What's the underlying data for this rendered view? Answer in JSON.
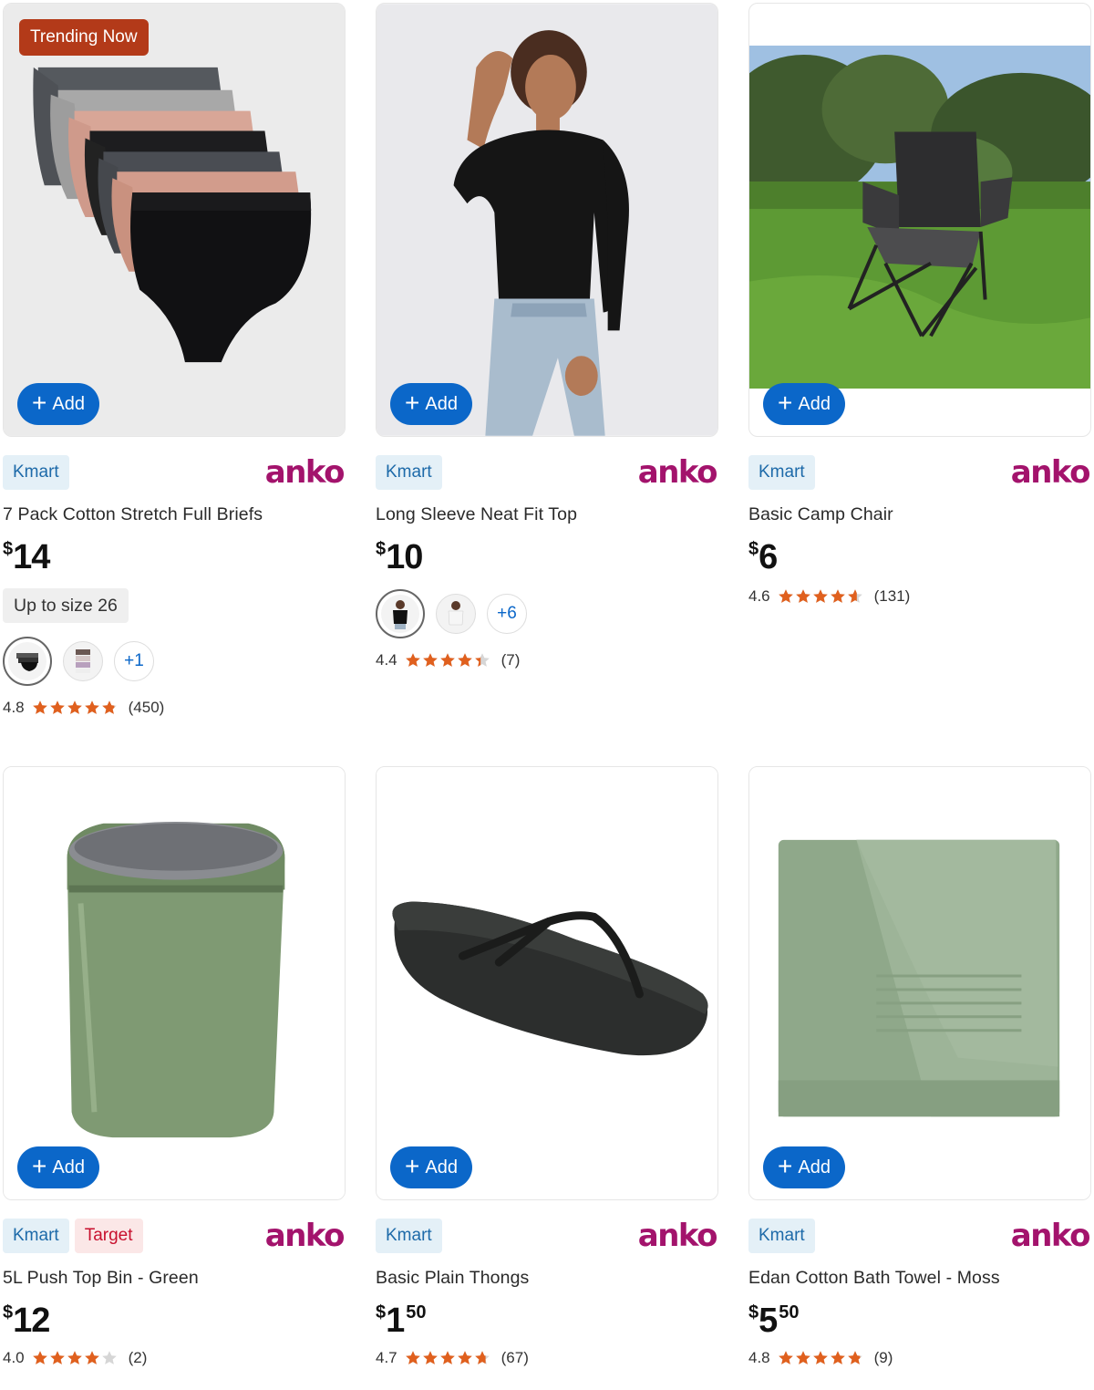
{
  "accent_color": "#0b67c9",
  "star_color": "#e0601e",
  "products": [
    {
      "trending": "Trending Now",
      "add_label": "Add",
      "stores": [
        "Kmart"
      ],
      "brand": "anko",
      "title": "7 Pack Cotton Stretch Full Briefs",
      "price": {
        "currency": "$",
        "whole": "14",
        "cents": ""
      },
      "size_note": "Up to size 26",
      "swatch_more": "+1",
      "rating": {
        "score": "4.8",
        "stars": 4.8,
        "count": "(450)"
      }
    },
    {
      "trending": "",
      "add_label": "Add",
      "stores": [
        "Kmart"
      ],
      "brand": "anko",
      "title": "Long Sleeve Neat Fit Top",
      "price": {
        "currency": "$",
        "whole": "10",
        "cents": ""
      },
      "size_note": "",
      "swatch_more": "+6",
      "rating": {
        "score": "4.4",
        "stars": 4.4,
        "count": "(7)"
      }
    },
    {
      "trending": "",
      "add_label": "Add",
      "stores": [
        "Kmart"
      ],
      "brand": "anko",
      "title": "Basic Camp Chair",
      "price": {
        "currency": "$",
        "whole": "6",
        "cents": ""
      },
      "size_note": "",
      "swatch_more": "",
      "rating": {
        "score": "4.6",
        "stars": 4.6,
        "count": "(131)"
      }
    },
    {
      "trending": "",
      "add_label": "Add",
      "stores": [
        "Kmart",
        "Target"
      ],
      "brand": "anko",
      "title": "5L Push Top Bin - Green",
      "price": {
        "currency": "$",
        "whole": "12",
        "cents": ""
      },
      "size_note": "",
      "swatch_more": "",
      "rating": {
        "score": "4.0",
        "stars": 4.0,
        "count": "(2)"
      }
    },
    {
      "trending": "",
      "add_label": "Add",
      "stores": [
        "Kmart"
      ],
      "brand": "anko",
      "title": "Basic Plain Thongs",
      "price": {
        "currency": "$",
        "whole": "1",
        "cents": "50"
      },
      "size_note": "",
      "swatch_more": "",
      "rating": {
        "score": "4.7",
        "stars": 4.7,
        "count": "(67)"
      }
    },
    {
      "trending": "",
      "add_label": "Add",
      "stores": [
        "Kmart"
      ],
      "brand": "anko",
      "title": "Edan Cotton Bath Towel - Moss",
      "price": {
        "currency": "$",
        "whole": "5",
        "cents": "50"
      },
      "size_note": "",
      "swatch_more": "",
      "rating": {
        "score": "4.8",
        "stars": 4.8,
        "count": "(9)"
      }
    }
  ]
}
